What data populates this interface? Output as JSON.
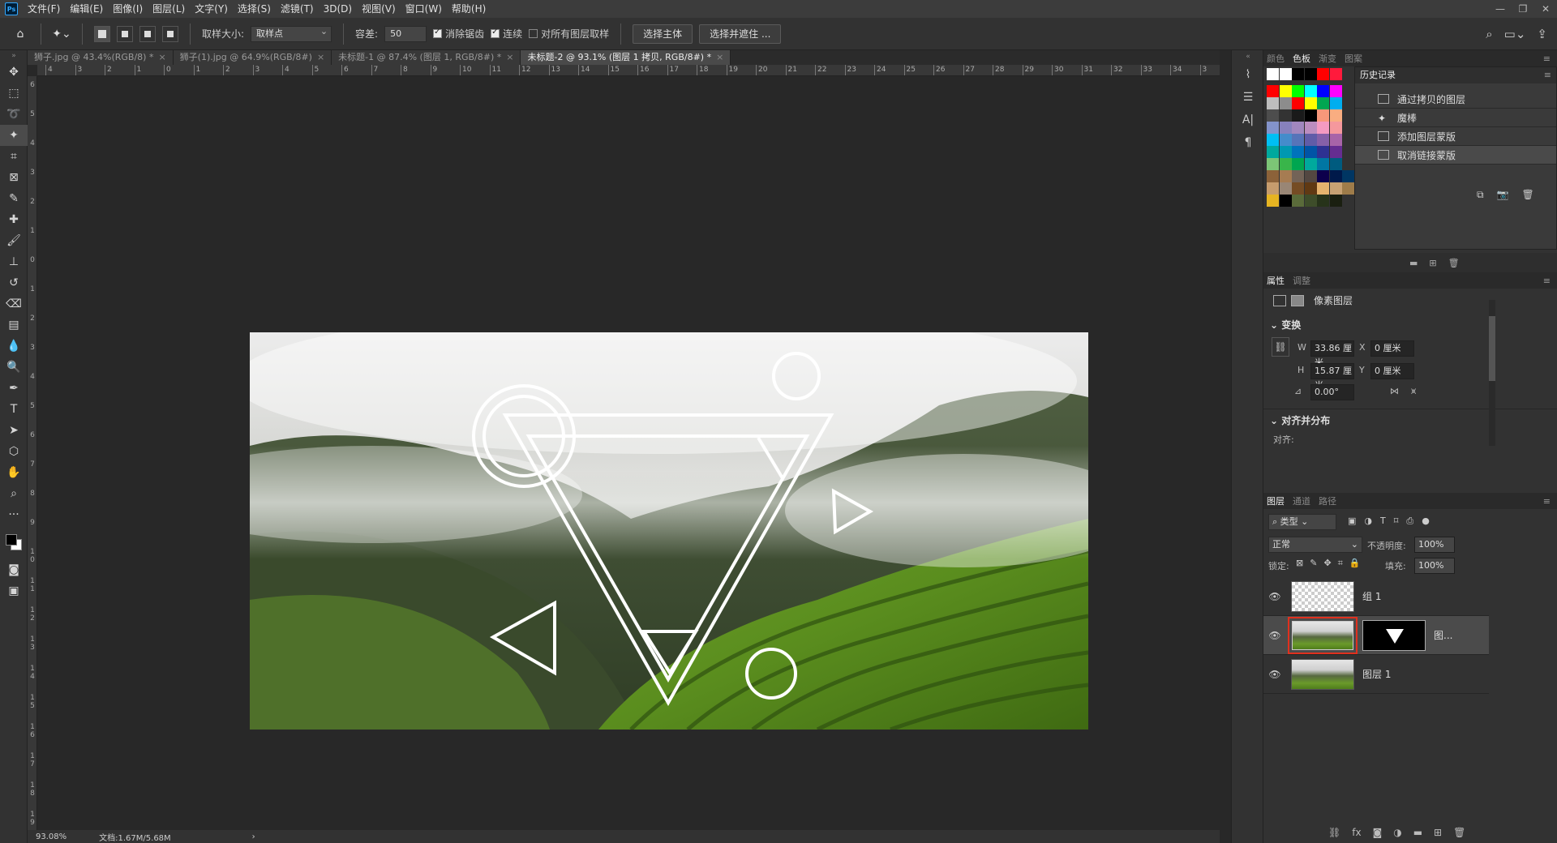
{
  "app": {
    "logo": "Ps"
  },
  "menu": [
    "文件(F)",
    "编辑(E)",
    "图像(I)",
    "图层(L)",
    "文字(Y)",
    "选择(S)",
    "滤镜(T)",
    "3D(D)",
    "视图(V)",
    "窗口(W)",
    "帮助(H)"
  ],
  "window_buttons": [
    "—",
    "❐",
    "✕"
  ],
  "options": {
    "sample_size_label": "取样大小:",
    "sample_size_value": "取样点",
    "tolerance_label": "容差:",
    "tolerance_value": "50",
    "antialias_label": "消除锯齿",
    "contiguous_label": "连续",
    "all_layers_label": "对所有图层取样",
    "select_subject": "选择主体",
    "select_mask": "选择并遮住 ..."
  },
  "tabs": [
    {
      "label": "狮子.jpg @ 43.4%(RGB/8) *"
    },
    {
      "label": "狮子(1).jpg @ 64.9%(RGB/8#)"
    },
    {
      "label": "未标题-1 @ 87.4% (图层 1, RGB/8#) *"
    },
    {
      "label": "未标题-2 @ 93.1% (图层 1 拷贝, RGB/8#) *"
    }
  ],
  "ruler_h": [
    "4",
    "3",
    "2",
    "1",
    "0",
    "1",
    "2",
    "3",
    "4",
    "5",
    "6",
    "7",
    "8",
    "9",
    "10",
    "11",
    "12",
    "13",
    "14",
    "15",
    "16",
    "17",
    "18",
    "19",
    "20",
    "21",
    "22",
    "23",
    "24",
    "25",
    "26",
    "27",
    "28",
    "29",
    "30",
    "31",
    "32",
    "33",
    "34",
    "3"
  ],
  "ruler_v": [
    "6",
    "5",
    "4",
    "3",
    "2",
    "1",
    "0",
    "1",
    "2",
    "3",
    "4",
    "5",
    "6",
    "7",
    "8",
    "9",
    "1 0",
    "1 1",
    "1 2",
    "1 3",
    "1 4",
    "1 5",
    "1 6",
    "1 7",
    "1 8",
    "1 9"
  ],
  "status": {
    "zoom": "93.08%",
    "doc": "文档:1.67M/5.68M"
  },
  "swatch_panel": {
    "tabs": [
      "颜色",
      "色板",
      "渐变",
      "图案"
    ],
    "active": "色板"
  },
  "history": {
    "title": "历史记录",
    "items": [
      "通过拷贝的图层",
      "魔棒",
      "添加图层蒙版",
      "取消链接蒙版"
    ]
  },
  "properties": {
    "tabs": [
      "属性",
      "调整"
    ],
    "type_label": "像素图层",
    "transform_label": "变换",
    "w_label": "W",
    "w_value": "33.86 厘米",
    "x_label": "X",
    "x_value": "0 厘米",
    "h_label": "H",
    "h_value": "15.87 厘米",
    "y_label": "Y",
    "y_value": "0 厘米",
    "angle_value": "0.00°",
    "align_label": "对齐并分布",
    "align_sub": "对齐:"
  },
  "layers": {
    "tabs": [
      "图层",
      "通道",
      "路径"
    ],
    "filter": "类型",
    "blend": "正常",
    "opacity_label": "不透明度:",
    "opacity_value": "100%",
    "lock_label": "锁定:",
    "fill_label": "填充:",
    "fill_value": "100%",
    "items": [
      {
        "name": "组 1"
      },
      {
        "name": "图..."
      },
      {
        "name": "图层 1"
      }
    ]
  },
  "colors": {
    "accent_red": "#e0301e"
  }
}
